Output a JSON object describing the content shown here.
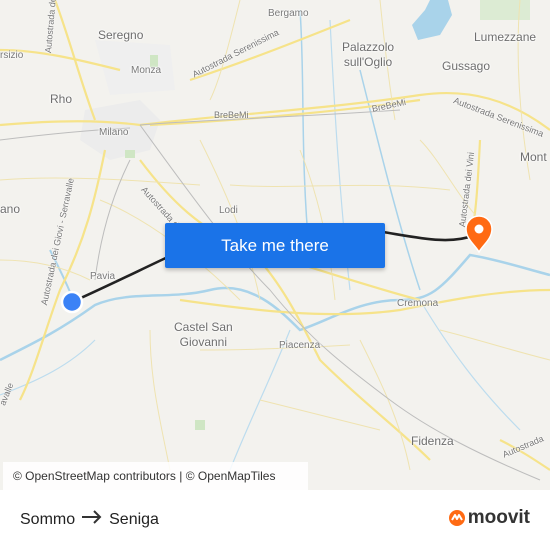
{
  "map": {
    "cities": {
      "seregno": "Seregno",
      "monza": "Monza",
      "bergamo": "Bergamo",
      "palazzolo": "Palazzolo\nsull'Oglio",
      "lumezzane": "Lumezzane",
      "gussago": "Gussago",
      "rho": "Rho",
      "milano": "Milano",
      "lodi": "Lodi",
      "pavia": "Pavia",
      "castel_san_giovanni": "Castel San\nGiovanni",
      "piacenza": "Piacenza",
      "cremona": "Cremona",
      "fidenza": "Fidenza",
      "arsizio_fragment": "rsizio",
      "ano_fragment": "ano",
      "mont_fragment": "Mont"
    },
    "roads": {
      "serenissima_1": "Autostrada Serenissima",
      "serenissima_2": "Autostrada Serenissima",
      "brebemi_1": "BreBeMi",
      "brebemi_2": "BreBeMi",
      "laghi": "Autostrada dei Laghi",
      "giovi": "Autostrada dei Giovi - Serravalle",
      "autostrada_del_sole_fragment": "Autostrada de",
      "vini": "Autostrada dei Vini",
      "serravalle_fragment": "avalle",
      "autostrada_fragment": "Autostrada"
    },
    "route_color": "#222222",
    "origin_marker_color": "#3b82f6",
    "destination_marker_color": "#ff6a13"
  },
  "cta": {
    "label": "Take me there",
    "color": "#1a73e8"
  },
  "attribution": "© OpenStreetMap contributors | © OpenMapTiles",
  "footer": {
    "origin": "Sommo",
    "destination": "Seniga",
    "arrow_icon": "arrow-right-icon"
  },
  "logo": {
    "text": "moovit",
    "icon": "moovit-logo-icon",
    "color": "#ff6a13"
  }
}
